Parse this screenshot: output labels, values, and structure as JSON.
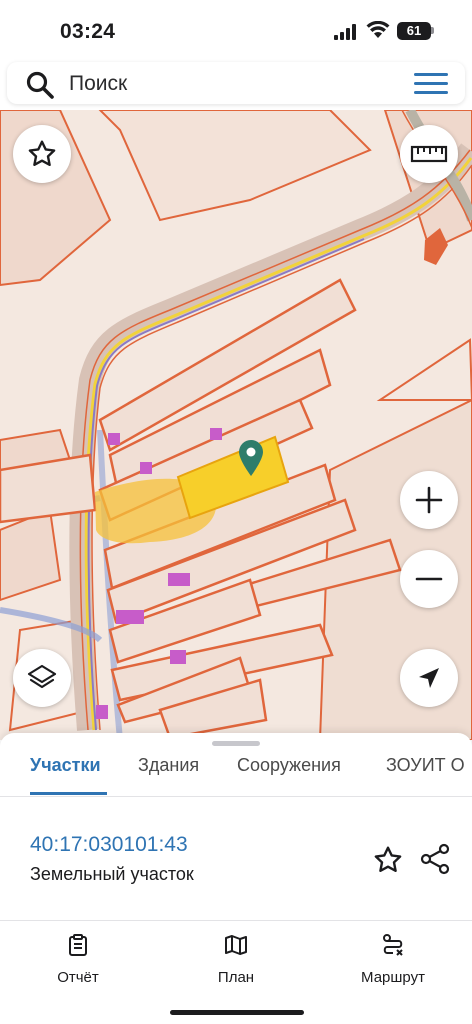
{
  "status_bar": {
    "time": "03:24",
    "battery": "61"
  },
  "search": {
    "placeholder": "Поиск",
    "search_icon": "search-icon",
    "menu_icon": "hamburger-menu-icon"
  },
  "map": {
    "buttons": {
      "favorites": "star-icon",
      "ruler": "ruler-icon",
      "zoom_in": "plus-icon",
      "zoom_out": "minus-icon",
      "layers": "layers-icon",
      "location": "location-arrow-icon"
    },
    "colors": {
      "parcel_border": "#e0663c",
      "selected_parcel": "#f7cf2a",
      "road": "#d7b8a8",
      "structure": "#c75cc9",
      "marker": "#2e7d6b"
    }
  },
  "sheet": {
    "tabs": [
      {
        "label": "Участки",
        "active": true
      },
      {
        "label": "Здания",
        "active": false
      },
      {
        "label": "Сооружения",
        "active": false
      },
      {
        "label": "ЗОУИТ О",
        "active": false
      }
    ],
    "parcel": {
      "cadastral_number": "40:17:030101:43",
      "type": "Земельный участок"
    }
  },
  "bottom_nav": [
    {
      "label": "Отчёт",
      "icon": "report-clipboard-icon"
    },
    {
      "label": "План",
      "icon": "map-plan-icon"
    },
    {
      "label": "Маршрут",
      "icon": "route-icon"
    }
  ],
  "accent_color": "#2f74b3"
}
